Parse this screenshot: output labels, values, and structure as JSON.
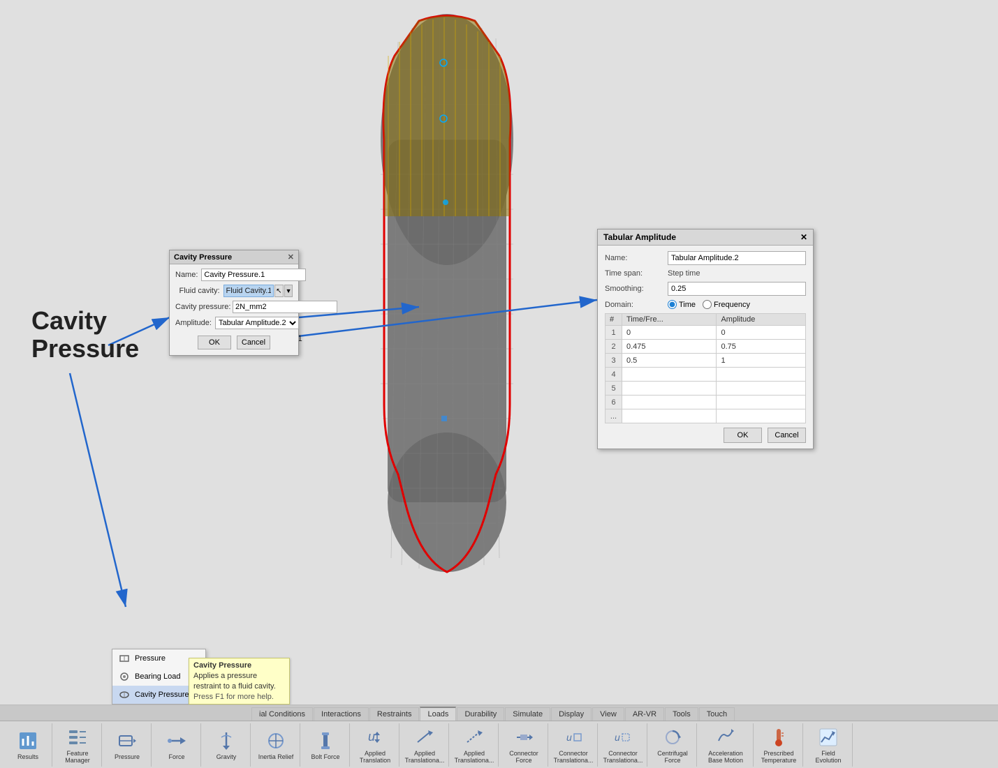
{
  "viewport": {
    "background": "#e0e0e0"
  },
  "cavityLabel": {
    "line1": "Cavity",
    "line2": "Pressure"
  },
  "cavityDialog": {
    "title": "Cavity Pressure",
    "nameLabel": "Name:",
    "nameValue": "Cavity Pressure.1",
    "fluidCavityLabel": "Fluid cavity:",
    "fluidCavityValue": "Fluid Cavity.1",
    "cavityPressureLabel": "Cavity pressure:",
    "cavityPressureValue": "2N_mm2",
    "amplitudeLabel": "Amplitude:",
    "amplitudeValue": "Tabular Amplitude.2",
    "okBtn": "OK",
    "cancelBtn": "Cancel"
  },
  "tabularDialog": {
    "title": "Tabular Amplitude",
    "nameLabel": "Name:",
    "nameValue": "Tabular Amplitude.2",
    "timeSpanLabel": "Time span:",
    "timeSpanValue": "Step time",
    "smoothingLabel": "Smoothing:",
    "smoothingValue": "0.25",
    "domainLabel": "Domain:",
    "domainTime": "Time",
    "domainFrequency": "Frequency",
    "tableHeaders": [
      "#",
      "Time/Fre...",
      "Amplitude"
    ],
    "tableRows": [
      {
        "num": "1",
        "time": "0",
        "amplitude": "0"
      },
      {
        "num": "2",
        "time": "0.475",
        "amplitude": "0.75"
      },
      {
        "num": "3",
        "time": "0.5",
        "amplitude": "1"
      },
      {
        "num": "4",
        "time": "",
        "amplitude": ""
      },
      {
        "num": "5",
        "time": "",
        "amplitude": ""
      },
      {
        "num": "6",
        "time": "",
        "amplitude": ""
      },
      {
        "num": "...",
        "time": "",
        "amplitude": ""
      }
    ],
    "okBtn": "OK",
    "cancelBtn": "Cancel"
  },
  "popupMenu": {
    "items": [
      {
        "label": "Pressure",
        "icon": "pressure"
      },
      {
        "label": "Bearing Load",
        "icon": "bearing"
      },
      {
        "label": "Cavity Pressure",
        "icon": "cavity",
        "active": true
      }
    ]
  },
  "tooltip": {
    "title": "Cavity Pressure",
    "body": "Applies a pressure restraint to a fluid cavity.",
    "hint": "Press F1 for more help."
  },
  "tabs": [
    "ial Conditions",
    "Interactions",
    "Restraints",
    "Loads",
    "Durability",
    "Simulate",
    "Display",
    "View",
    "AR-VR",
    "Tools",
    "Touch"
  ],
  "toolbar": {
    "tools": [
      {
        "label": "Results",
        "icon": "results"
      },
      {
        "label": "Feature Manager",
        "icon": "feature"
      },
      {
        "label": "Pressure",
        "icon": "pressure"
      },
      {
        "label": "Force",
        "icon": "force"
      },
      {
        "label": "Gravity",
        "icon": "gravity"
      },
      {
        "label": "Inertia Relief",
        "icon": "inertia"
      },
      {
        "label": "Bolt Force",
        "icon": "bolt"
      },
      {
        "label": "Applied Translation",
        "icon": "applied-trans"
      },
      {
        "label": "Applied Translationa...",
        "icon": "applied-trans2"
      },
      {
        "label": "Applied Translationa...",
        "icon": "applied-trans3"
      },
      {
        "label": "Connector Force",
        "icon": "connector-force"
      },
      {
        "label": "Connector Translationa...",
        "icon": "connector-trans"
      },
      {
        "label": "Connector Translationa...",
        "icon": "connector-trans2"
      },
      {
        "label": "Centrifugal Force",
        "icon": "centrifugal"
      },
      {
        "label": "Acceleration Base Motion",
        "icon": "acceleration"
      },
      {
        "label": "Prescribed Temperature",
        "icon": "temperature"
      },
      {
        "label": "Field Evolution",
        "icon": "field"
      }
    ]
  }
}
